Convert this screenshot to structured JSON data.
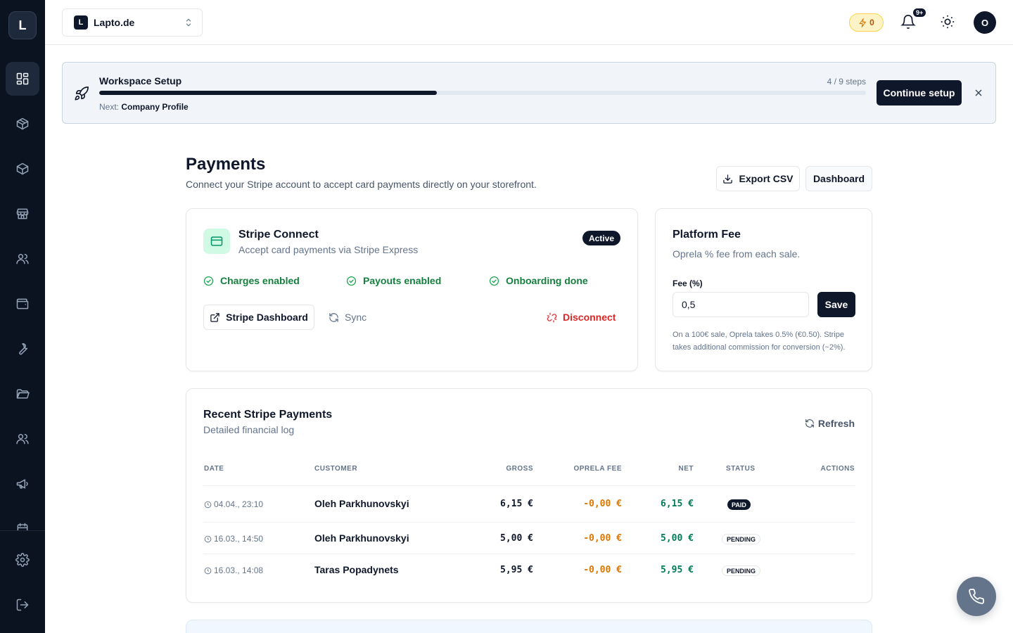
{
  "sidebar": {
    "logo_letter": "L",
    "items": [
      {
        "icon": "dashboard-icon"
      },
      {
        "icon": "package-icon"
      },
      {
        "icon": "box-icon"
      },
      {
        "icon": "store-icon"
      },
      {
        "icon": "users-icon"
      },
      {
        "icon": "wallet-icon"
      },
      {
        "icon": "wrench-icon"
      },
      {
        "icon": "folder-icon"
      },
      {
        "icon": "team-icon"
      },
      {
        "icon": "megaphone-icon"
      },
      {
        "icon": "calendar-icon"
      }
    ],
    "bottom_items": [
      {
        "icon": "settings-icon"
      },
      {
        "icon": "logout-icon"
      }
    ]
  },
  "topbar": {
    "workspace_badge": "L",
    "workspace_name": "Lapto.de",
    "credits": "0",
    "notifications_count": "9+",
    "avatar_letter": "O"
  },
  "setup": {
    "title": "Workspace Setup",
    "steps": "4 / 9 steps",
    "progress": 0.44,
    "next_label": "Next:",
    "next_value": "Company Profile",
    "continue_label": "Continue setup"
  },
  "page": {
    "title": "Payments",
    "subtitle": "Connect your Stripe account to accept card payments directly on your storefront.",
    "export_label": "Export CSV",
    "dashboard_label": "Dashboard"
  },
  "stripe_connect": {
    "title": "Stripe Connect",
    "subtitle": "Accept card payments via Stripe Express",
    "status": "Active",
    "checks": [
      "Charges enabled",
      "Payouts enabled",
      "Onboarding done"
    ],
    "dashboard_button": "Stripe Dashboard",
    "sync_button": "Sync",
    "disconnect_button": "Disconnect"
  },
  "platform_fee": {
    "title": "Platform Fee",
    "subtitle": "Oprela % fee from each sale.",
    "fee_label": "Fee (%)",
    "fee_value": "0,5",
    "save_label": "Save",
    "note": "On a 100€ sale, Oprela takes 0.5% (€0.50). Stripe takes additional commission for conversion (~2%)."
  },
  "recent_payments": {
    "title": "Recent Stripe Payments",
    "subtitle": "Detailed financial log",
    "refresh_label": "Refresh",
    "columns": [
      "DATE",
      "CUSTOMER",
      "GROSS",
      "OPRELA FEE",
      "NET",
      "STATUS",
      "ACTIONS"
    ],
    "rows": [
      {
        "date": "04.04., 23:10",
        "customer": "Oleh Parkhunovskyi",
        "gross": "6,15 €",
        "fee": "-0,00 €",
        "net": "6,15 €",
        "status": "PAID"
      },
      {
        "date": "16.03., 14:50",
        "customer": "Oleh Parkhunovskyi",
        "gross": "5,00 €",
        "fee": "-0,00 €",
        "net": "5,00 €",
        "status": "PENDING"
      },
      {
        "date": "16.03., 14:08",
        "customer": "Taras Popadynets",
        "gross": "5,95 €",
        "fee": "-0,00 €",
        "net": "5,95 €",
        "status": "PENDING"
      }
    ]
  },
  "colors": {
    "sidebar_bg": "#0b1220",
    "primary": "#0f172a",
    "success": "#15803d",
    "danger": "#dc2626",
    "fee": "#d97706"
  }
}
